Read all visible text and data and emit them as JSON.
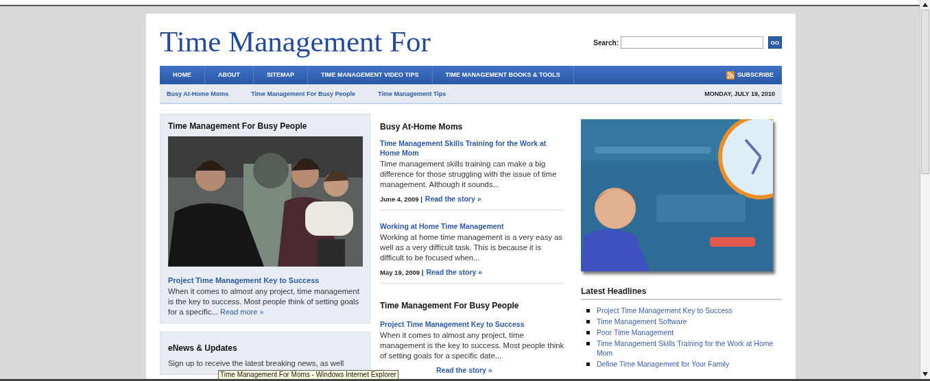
{
  "site_title": "Time Management For",
  "search": {
    "label": "Search:",
    "button": "GO"
  },
  "nav": [
    "HOME",
    "ABOUT",
    "SITEMAP",
    "TIME MANAGEMENT VIDEO TIPS",
    "TIME MANAGEMENT BOOKS & TOOLS"
  ],
  "subscribe": "SUBSCRIBE",
  "subnav": [
    "Busy At-Home Moms",
    "Time Management For Busy People",
    "Time Management Tips"
  ],
  "date": "MONDAY, JULY 19, 2010",
  "featured": {
    "heading": "Time Management For Busy People",
    "link": "Project Time Management Key to Success",
    "excerpt": "When it comes to almost any project, time management is the key to success. Most people think of setting goals for a specific...",
    "more": "Read more »"
  },
  "enews": {
    "heading": "eNews & Updates",
    "text": "Sign up to receive the latest breaking news, as well"
  },
  "middle_sections": [
    {
      "heading": "Busy At-Home Moms",
      "posts": [
        {
          "title": "Time Management Skills Training for the Work at Home Mom",
          "excerpt": "Time management skills training can make a big difference for those struggling with the issue of time management.  Although it sounds...",
          "date": "June 4, 2009 |",
          "more": "Read the story »"
        },
        {
          "title": "Working at Home Time Management",
          "excerpt": "Working at home time management is a very easy as well as a very difficult task. This is because it is difficult to be focused when...",
          "date": "May 19, 2009 |",
          "more": "Read the story »"
        }
      ]
    },
    {
      "heading": "Time Management For Busy People",
      "posts": [
        {
          "title": "Project Time Management Key to Success",
          "excerpt": "When it comes to almost any project, time management is the key to success. Most people think of setting goals for a specific date...",
          "more": "Read the story »"
        }
      ]
    }
  ],
  "headlines": {
    "heading": "Latest Headlines",
    "items": [
      "Project Time Management Key to Success",
      "Time Management Software",
      "Poor Time Management",
      "Time Management Skills Training for the Work at Home Mom",
      "Define Time Management for Your Family"
    ]
  },
  "tooltip": "Time Management For Moms - Windows Internet Explorer"
}
